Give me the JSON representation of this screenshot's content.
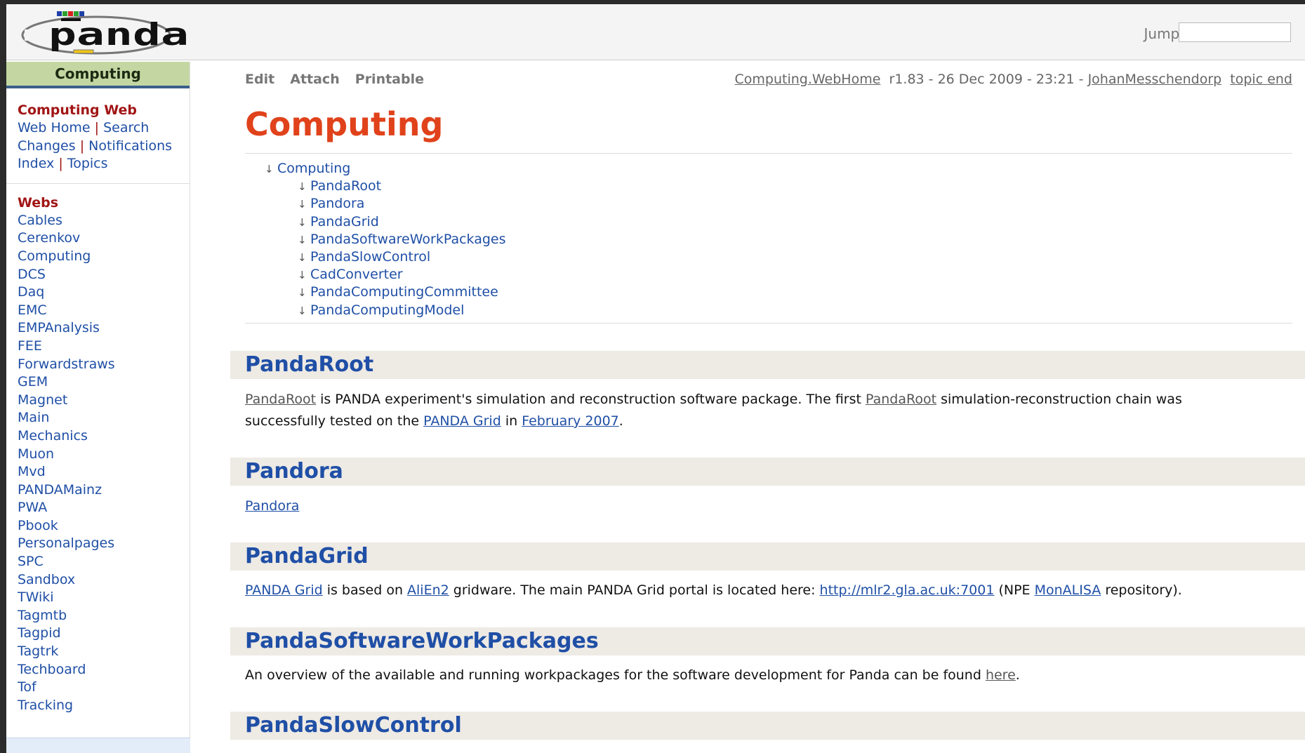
{
  "header": {
    "jump_label": "Jump:",
    "jump_value": ""
  },
  "sidebar": {
    "title": "Computing",
    "web_name": "Computing Web",
    "links": {
      "web_home": "Web Home",
      "search": "Search",
      "changes": "Changes",
      "notifications": "Notifications",
      "index": "Index",
      "topics": "Topics",
      "separator": "|"
    },
    "webs_heading": "Webs",
    "webs": [
      "Cables",
      "Cerenkov",
      "Computing",
      "DCS",
      "Daq",
      "EMC",
      "EMPAnalysis",
      "FEE",
      "Forwardstraws",
      "GEM",
      "Magnet",
      "Main",
      "Mechanics",
      "Muon",
      "Mvd",
      "PANDAMainz",
      "PWA",
      "Pbook",
      "Personalpages",
      "SPC",
      "Sandbox",
      "TWiki",
      "Tagmtb",
      "Tagpid",
      "Tagtrk",
      "Techboard",
      "Tof",
      "Tracking"
    ]
  },
  "topbar": {
    "edit": "Edit",
    "attach": "Attach",
    "printable": "Printable",
    "topic_path": "Computing.WebHome",
    "revision": "r1.83 - 26 Dec 2009 - 23:21 -",
    "author": "JohanMesschendorp",
    "topic_end": "topic end"
  },
  "page": {
    "title": "Computing"
  },
  "toc": {
    "arrow": "↓",
    "root": "Computing",
    "items": [
      "PandaRoot",
      "Pandora",
      "PandaGrid",
      "PandaSoftwareWorkPackages",
      "PandaSlowControl",
      "CadConverter",
      "PandaComputingCommittee",
      "PandaComputingModel"
    ]
  },
  "sections": {
    "pandaroot": {
      "heading": "PandaRoot",
      "t1": "PandaRoot",
      "t2": " is PANDA experiment's simulation and reconstruction software package. The first ",
      "t3": "PandaRoot",
      "t4": " simulation-reconstruction chain was",
      "t5": "successfully tested on the ",
      "t6": "PANDA Grid",
      "t7": " in ",
      "t8": "February 2007",
      "t9": "."
    },
    "pandora": {
      "heading": "Pandora",
      "link": "Pandora"
    },
    "pandagrid": {
      "heading": "PandaGrid",
      "t1": "PANDA Grid",
      "t2": " is based on ",
      "t3": "AliEn2",
      "t4": " gridware. The main PANDA Grid portal is located here: ",
      "t5": "http://mlr2.gla.ac.uk:7001",
      "t6": " (NPE ",
      "t7": "MonALISA",
      "t8": " repository)."
    },
    "workpackages": {
      "heading": "PandaSoftwareWorkPackages",
      "t1": "An overview of the available and running workpackages for the software development for Panda can be found ",
      "t2": "here",
      "t3": "."
    },
    "slowcontrol": {
      "heading": "PandaSlowControl"
    }
  },
  "colors": {
    "accent": "#e0421b",
    "link": "#1f4fa6",
    "web_red": "#a11515",
    "sidebar_title_bg": "#c4d7a3",
    "section_bg": "#eeeae4"
  },
  "logo_text": "panda"
}
